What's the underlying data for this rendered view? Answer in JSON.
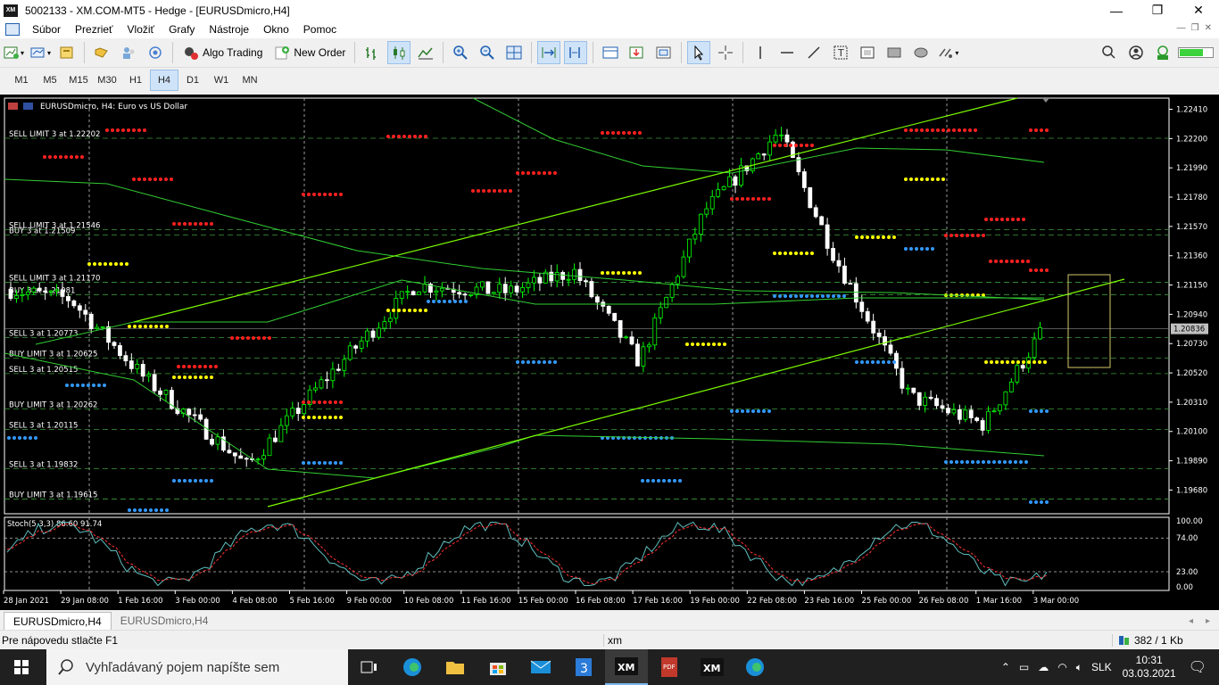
{
  "window": {
    "title": "5002133 - XM.COM-MT5 - Hedge - [EURUSDmicro,H4]",
    "minimize": "—",
    "maximize": "❐",
    "close": "✕",
    "app_icon_text": "XM"
  },
  "menu": {
    "items": [
      "Súbor",
      "Prezrieť",
      "Vložiť",
      "Grafy",
      "Nástroje",
      "Okno",
      "Pomoc"
    ]
  },
  "toolbar": {
    "algo_trading": "Algo Trading",
    "new_order": "New Order"
  },
  "timeframes": {
    "items": [
      "M1",
      "M5",
      "M15",
      "M30",
      "H1",
      "H4",
      "D1",
      "W1",
      "MN"
    ],
    "active": "H4"
  },
  "chart": {
    "symbol_label": "EURUSDmicro, H4:  Euro vs US Dollar",
    "stoch_label": "Stoch(5,3,3) 86.60 91.74",
    "current_price": "1.20836",
    "price_ticks": [
      "1.22410",
      "1.22200",
      "1.21990",
      "1.21780",
      "1.21570",
      "1.21360",
      "1.21150",
      "1.20940",
      "1.20730",
      "1.20520",
      "1.20310",
      "1.20100",
      "1.19890",
      "1.19680"
    ],
    "stoch_ticks": [
      "100.00",
      "74.00",
      "23.00",
      "0.00"
    ],
    "time_ticks": [
      "28 Jan 2021",
      "29 Jan 08:00",
      "1 Feb 16:00",
      "3 Feb 00:00",
      "4 Feb 08:00",
      "5 Feb 16:00",
      "9 Feb 00:00",
      "10 Feb 08:00",
      "11 Feb 16:00",
      "15 Feb 00:00",
      "16 Feb 08:00",
      "17 Feb 16:00",
      "19 Feb 00:00",
      "22 Feb 08:00",
      "23 Feb 16:00",
      "25 Feb 00:00",
      "26 Feb 08:00",
      "1 Mar 16:00",
      "3 Mar 00:00"
    ],
    "order_labels": [
      "SELL LIMIT 3 at 1.22202",
      "SELL LIMIT 3 at 1.21546",
      "BUY 3 at 1.21509",
      "SELL LIMIT 3 at 1.21170",
      "BUY 3 at 1.21081",
      "SELL 3 at 1.20773",
      "BUY LIMIT 3 at 1.20625",
      "SELL 3 at 1.20515",
      "BUY LIMIT 3 at 1.20262",
      "SELL 3 at 1.20115",
      "SELL 3 at 1.19832",
      "BUY LIMIT 3 at 1.19615"
    ],
    "colors": {
      "bull": "#00ff00",
      "bear": "#ffffff",
      "sell_dots": "#ff2020",
      "buy_dots": "#3399ff",
      "mid_dots": "#ffff00",
      "ma": "#32cd32",
      "grid": "#c0c0c0",
      "stoch_main": "#5fbfbf",
      "stoch_signal": "#ff3030"
    }
  },
  "chart_tabs": {
    "items": [
      "EURUSDmicro,H4",
      "EURUSDmicro,H4"
    ]
  },
  "status": {
    "help": "Pre nápovedu stlačte F1",
    "profile": "xm",
    "traffic": "382 / 1 Kb"
  },
  "taskbar": {
    "search_placeholder": "Vyhľadávaný pojem napíšte sem",
    "lang": "SLK",
    "time": "10:31",
    "date": "03.03.2021"
  }
}
